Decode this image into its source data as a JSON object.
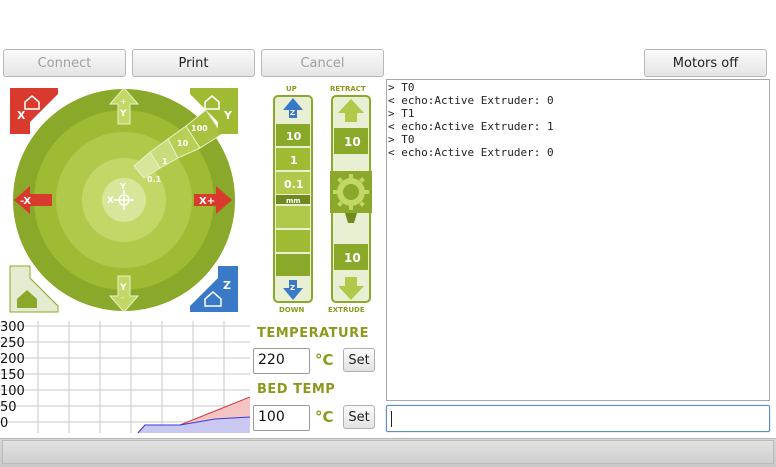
{
  "toolbar": {
    "connect_label": "Connect",
    "print_label": "Print",
    "cancel_label": "Cancel",
    "motors_off_label": "Motors off"
  },
  "xy_jog": {
    "y_plus": "+",
    "y_label": "Y",
    "y_minus": "-",
    "x_minus_label": "-X",
    "x_plus_label": "X+",
    "step_small": "0.1",
    "step_1": "1",
    "step_10": "10",
    "step_100": "100",
    "home_x_label": "X",
    "home_y_label": "Y",
    "home_z_label": "Z",
    "center_x": "X",
    "center_y": "Y"
  },
  "z_jog": {
    "up_label": "UP",
    "down_label": "DOWN",
    "steps": [
      "10",
      "1",
      "0.1"
    ],
    "unit": "mm",
    "z_label": "Z"
  },
  "extruder": {
    "retract_label": "RETRACT",
    "extrude_label": "EXTRUDE",
    "retract_amount": "10",
    "extrude_amount": "10"
  },
  "temperature": {
    "title": "TEMPERATURE",
    "value": "220",
    "unit": "°C",
    "set_label": "Set"
  },
  "bed": {
    "title": "BED TEMP",
    "value": "100",
    "unit": "°C",
    "set_label": "Set"
  },
  "graph": {
    "y_ticks": [
      "300",
      "250",
      "200",
      "150",
      "100",
      "50",
      "0"
    ],
    "colors": {
      "hotend": "#d63a3a",
      "bed": "#3a3ad6"
    }
  },
  "console": {
    "lines": [
      "> T0",
      "< echo:Active Extruder: 0",
      "> T1",
      "< echo:Active Extruder: 1",
      "> T0",
      "< echo:Active Extruder: 0"
    ],
    "input_value": ""
  },
  "colors": {
    "jog_green": "#8aa82a",
    "jog_light": "#b8cf55",
    "accent_red": "#d93a2e",
    "accent_blue": "#3a78c8",
    "label_olive": "#8a9a1c"
  }
}
